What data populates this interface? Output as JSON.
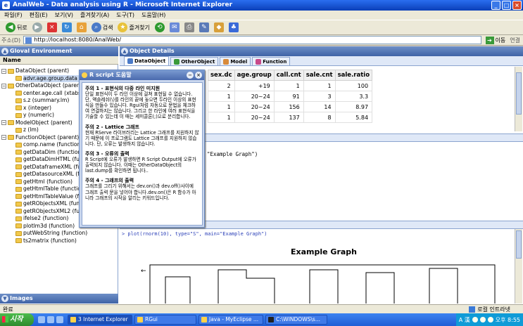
{
  "window": {
    "title": "AnalWeb - Data analysis using R - Microsoft Internet Explorer",
    "min": "_",
    "max": "□",
    "close": "×"
  },
  "menu": [
    "파일(F)",
    "편집(E)",
    "보기(V)",
    "즐겨찾기(A)",
    "도구(T)",
    "도움말(H)"
  ],
  "toolbar": {
    "back": "뒤로",
    "search": "검색",
    "favorites": "즐겨찾기"
  },
  "address": {
    "label": "주소(D)",
    "url": "http://localhost:8080/AnalWeb/",
    "go": "이동",
    "links": "연결"
  },
  "left_panel": {
    "title": "Gloval Environment",
    "column": "Name",
    "tree": [
      {
        "label": "DataObject (parent)",
        "level": 0,
        "expander": "−"
      },
      {
        "label": "advr.age.group.data (c",
        "level": 1,
        "selected": true
      },
      {
        "label": "OtherDataObject (parent)",
        "level": 0,
        "expander": "−"
      },
      {
        "label": "center.age.call (xtabs)",
        "level": 1
      },
      {
        "label": "s.z (summary.lm)",
        "level": 1
      },
      {
        "label": "x (integer)",
        "level": 1
      },
      {
        "label": "y (numeric)",
        "level": 1
      },
      {
        "label": "ModelObject (parent)",
        "level": 0,
        "expander": "−"
      },
      {
        "label": "z (lm)",
        "level": 1
      },
      {
        "label": "FunctionObject (parent)",
        "level": 0,
        "expander": "−"
      },
      {
        "label": "comp.name (function)",
        "level": 1
      },
      {
        "label": "getDataDim (function)",
        "level": 1
      },
      {
        "label": "getDataDimHTML (function",
        "level": 1
      },
      {
        "label": "getDataframeXML (functio",
        "level": 1
      },
      {
        "label": "getDatasourceXML (functio",
        "level": 1
      },
      {
        "label": "getHtml (function)",
        "level": 1
      },
      {
        "label": "getHtmlTable (function)",
        "level": 1
      },
      {
        "label": "getHtmlTableValue (functi",
        "level": 1
      },
      {
        "label": "getRObjectsXML (function",
        "level": 1
      },
      {
        "label": "getRObjectsXML2 (functio",
        "level": 1
      },
      {
        "label": "ifelse2 (function)",
        "level": 1
      },
      {
        "label": "plotlm3d (function)",
        "level": 1
      },
      {
        "label": "putWebString (function)",
        "level": 1
      },
      {
        "label": "ts2matrix (function)",
        "level": 1
      }
    ],
    "images_title": "Images"
  },
  "right_panel": {
    "title": "Object Details",
    "tabs": [
      "DataObject",
      "OtherObject",
      "Model",
      "Function"
    ]
  },
  "table": {
    "columns": [
      "sex.dc",
      "age.group",
      "call.cnt",
      "sale.cnt",
      "sale.ratio"
    ],
    "rows": [
      [
        "2",
        "+19",
        "1",
        "1",
        "100"
      ],
      [
        "1",
        "20~24",
        "91",
        "3",
        "3.3"
      ],
      [
        "1",
        "20~24",
        "156",
        "14",
        "8.97"
      ],
      [
        "1",
        "20~24",
        "137",
        "8",
        "5.84"
      ]
    ]
  },
  "script": {
    "text": "\"Example Graph\")"
  },
  "output": {
    "command": "> plot(rnorm(10), type=\"S\", main=\"Example Graph\")",
    "graph_title": "Example Graph",
    "arrow": "←"
  },
  "popup": {
    "title": "R script 도움말",
    "min": "−",
    "close": "×",
    "notes": [
      {
        "heading": "주의 1 - 표현식의 다중 라인 미지원",
        "body": "단일 표현식이 두 라인 이상에 걸쳐 표현될 수 없습니다. 단, 액숄레쉬(\\)를 라인의 끝에 놓으면 두라인 이상의 표현식을 만들수 있습니다. Rgui처럼 자동으로 문법을 체크하여 연결하지는 않습니다. 그리고 한 라인에 여러 표현식을 기술할 수 있는데 이 때는 세미콜론(;)으로 분리합니다."
      },
      {
        "heading": "주의 2 - Lattice 그래프",
        "body": "현재 RServe 라이브러리는 Lattice 그래프를 지원하지 않기 때문에 이 프로그램도 Lattice 그래프를 지원하지 않습니다. 단, 오류는 발생하지 않습니다."
      },
      {
        "heading": "주의 3 - 오류의 출력",
        "body": "R Script에 오류가 발생하면 R Script Output에 오류가 출력되지 않습니다. 이때는 OtherDataObject의 last.dump를 확인하면 됩니다.."
      },
      {
        "heading": "주의 4 - 그래프의 출력",
        "body": "그래프를 그리기 위해서는 dev.on()과 dev.off()사이에 그래프 출력 문을 넣어야 합니다.dev.on()은 R 함수가 아니라 그래프의 시작을 알리는 키워드입니다."
      }
    ]
  },
  "status": {
    "left": "완료",
    "zone": "로컬 인트라넷"
  },
  "taskbar": {
    "start": "시작",
    "tasks": [
      "3 Internet Explorer",
      "RGui",
      "Java - MyEclipse ...",
      "C:\\WINDOWS\\s..."
    ],
    "tray_lang": "A 漢",
    "clock": "오후 8:55"
  },
  "colors": {
    "title_blue": "#0a3fb8",
    "panel_header": "#3f63a6",
    "panel_bg": "#dfe8f7",
    "start_green": "#2e8b2e"
  }
}
